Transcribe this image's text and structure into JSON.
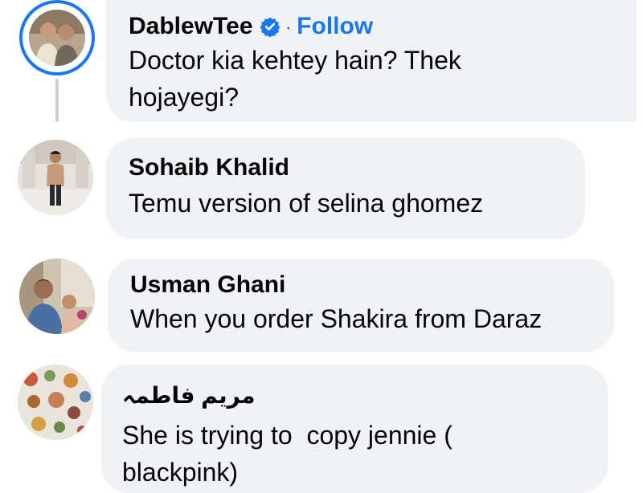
{
  "comments": [
    {
      "author": "DablewTee",
      "verified": true,
      "follow_label": "Follow",
      "text": "Doctor kia kehtey hain? Thek hojayegi?",
      "avatar": "two-men-selfie-photo"
    },
    {
      "author": "Sohaib Khalid",
      "text": "Temu version of selina ghomez",
      "avatar": "man-standing-in-mall-photo"
    },
    {
      "author": "Usman Ghani",
      "text": "When you order Shakira from Daraz",
      "avatar": "man-with-child-photo"
    },
    {
      "author": "مریم فاطمہ",
      "text": "She is trying to  copy jennie ( blackpink)",
      "avatar": "crafts-collage-photo"
    }
  ],
  "colors": {
    "bubble": "#f0f2f5",
    "link": "#1877f2",
    "story_ring": "#1877f2",
    "thread_line": "#ced0d4"
  },
  "icons": {
    "verified": "verified-badge-icon"
  }
}
